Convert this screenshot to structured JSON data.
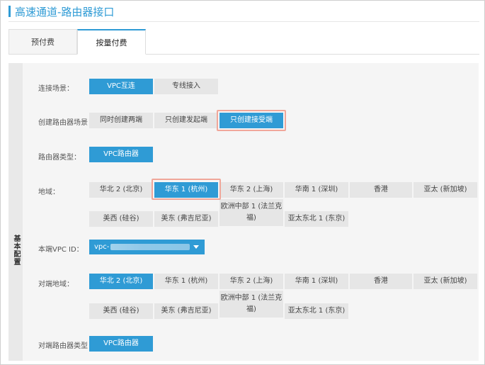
{
  "page_title": "高速通道-路由器接口",
  "tabs": [
    "预付费",
    "按量付费"
  ],
  "section_label": "基本配置",
  "scene": {
    "label": "连接场景：",
    "options": [
      "VPC互连",
      "专线接入"
    ]
  },
  "router_scene": {
    "label": "创建路由器场景",
    "options": [
      "同时创建两端",
      "只创建发起端",
      "只创建接受端"
    ]
  },
  "router_type": {
    "label": "路由器类型：",
    "value": "VPC路由器"
  },
  "region": {
    "label": "地域：",
    "options": [
      "华北 2 (北京)",
      "华东 1 (杭州)",
      "华东 2 (上海)",
      "华南 1 (深圳)",
      "香港",
      "亚太 (新加坡)",
      "美西 (硅谷)",
      "美东 (弗吉尼亚)",
      "欧洲中部 1 (法兰克福)",
      "亚太东北 1 (东京)"
    ]
  },
  "local_vpc": {
    "label": "本端VPC ID：",
    "value_prefix": "vpc-"
  },
  "peer_region": {
    "label": "对端地域：",
    "options": [
      "华北 2 (北京)",
      "华东 1 (杭州)",
      "华东 2 (上海)",
      "华南 1 (深圳)",
      "香港",
      "亚太 (新加坡)",
      "美西 (硅谷)",
      "美东 (弗吉尼亚)",
      "欧洲中部 1 (法兰克福)",
      "亚太东北 1 (东京)"
    ]
  },
  "peer_router_type": {
    "label": "对端路由器类型",
    "value": "VPC路由器"
  },
  "colors": {
    "accent": "#2f9bd5",
    "highlight": "#f0a79a"
  }
}
